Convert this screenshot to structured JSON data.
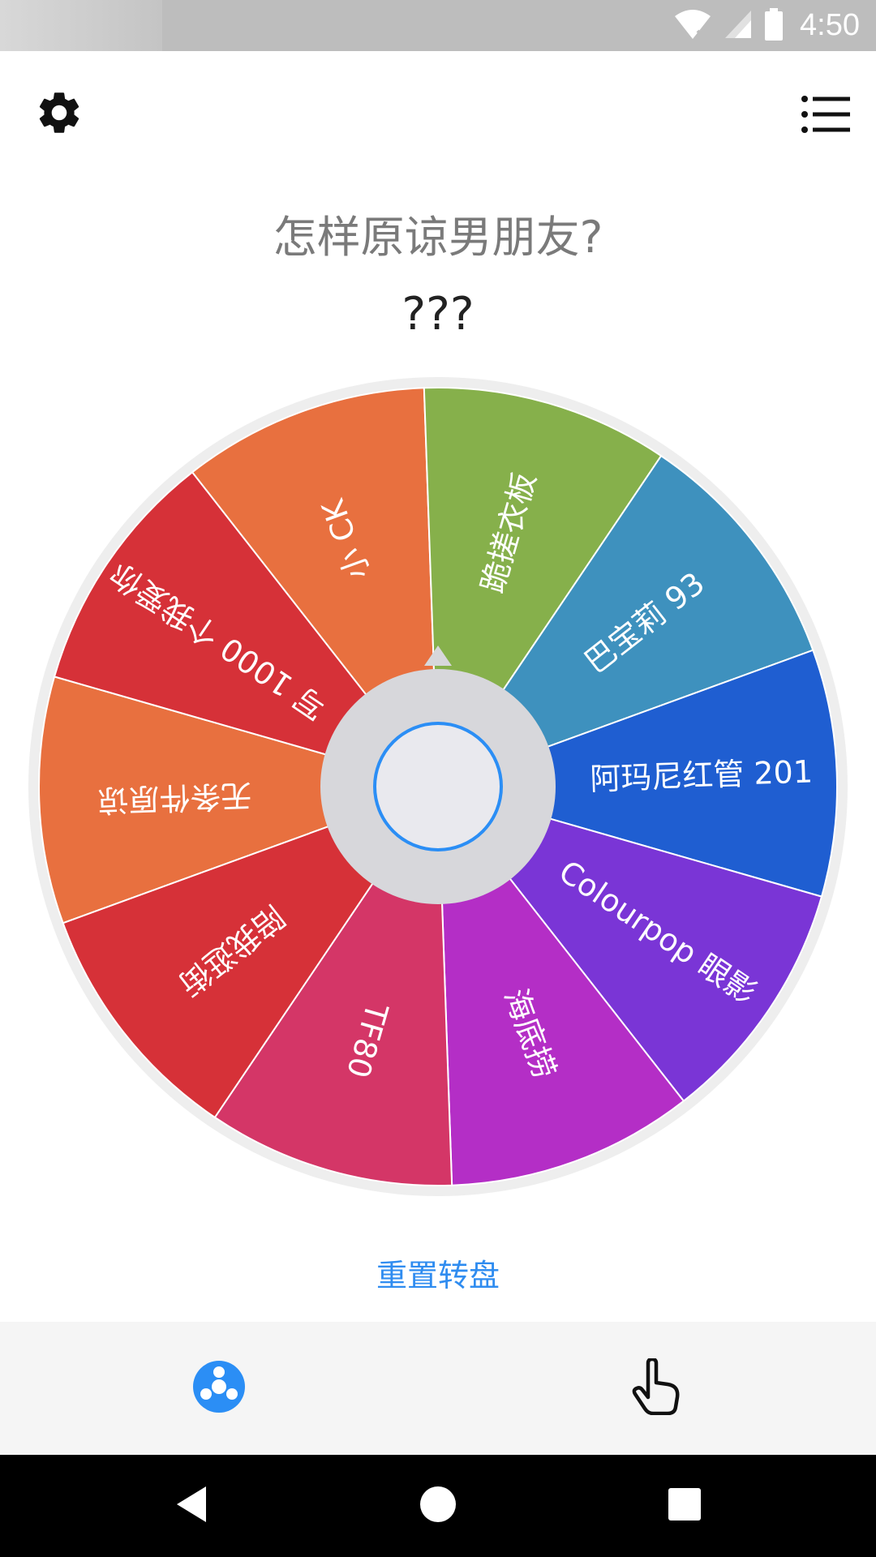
{
  "status_bar": {
    "time": "4:50"
  },
  "header": {
    "settings_icon": "gear-icon",
    "list_icon": "list-icon"
  },
  "wheel": {
    "title": "怎样原谅男朋友?",
    "result": "???",
    "segments": [
      {
        "label": "无条件原谅",
        "color": "#e8703f"
      },
      {
        "label": "写 1000 个我爱你",
        "color": "#d63138"
      },
      {
        "label": "小 CK",
        "color": "#e8703f"
      },
      {
        "label": "跪搓衣板",
        "color": "#86b04b"
      },
      {
        "label": "巴宝莉 93",
        "color": "#3e91be"
      },
      {
        "label": "阿玛尼红管 201",
        "color": "#1f5ed1"
      },
      {
        "label": "Colourpop 眼影",
        "color": "#7a35d6"
      },
      {
        "label": "海底捞",
        "color": "#b42ec6"
      },
      {
        "label": "TF80",
        "color": "#d43667"
      },
      {
        "label": "陪我逛街",
        "color": "#d63138"
      }
    ],
    "hub_color": "#d7d7db",
    "ring_color": "#2b8ef5"
  },
  "actions": {
    "reset_label": "重置转盘"
  },
  "bottom_nav": {
    "items": [
      {
        "icon": "wheel-icon",
        "active": true,
        "color": "#2b8ef5"
      },
      {
        "icon": "hand-pointer-icon",
        "active": false,
        "color": "#111111"
      }
    ]
  },
  "system_nav": {
    "back": "back-icon",
    "home": "home-icon",
    "recents": "recents-icon"
  }
}
